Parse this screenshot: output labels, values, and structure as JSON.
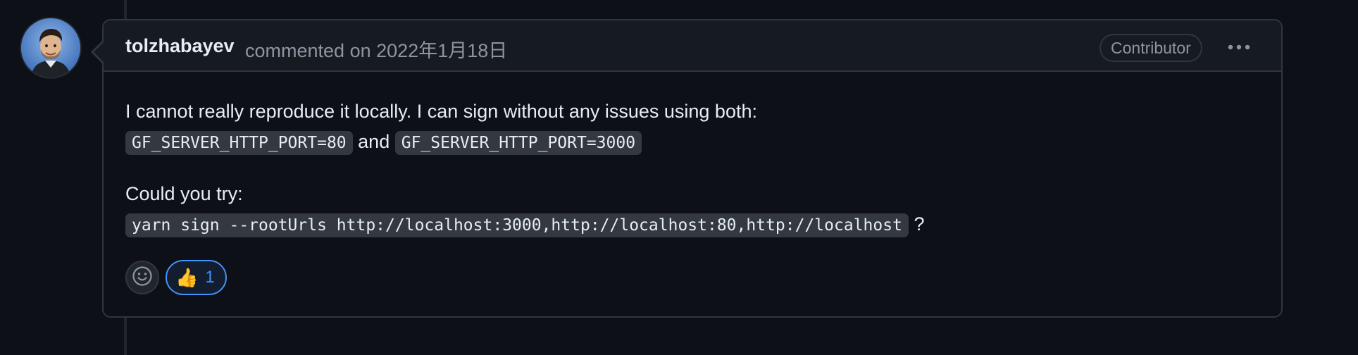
{
  "comment": {
    "author": "tolzhabayev",
    "action_text": "commented on",
    "date": "2022年1月18日",
    "role_badge": "Contributor",
    "more_icon": "kebab-horizontal-icon",
    "body": {
      "p1_text": "I cannot really reproduce it locally. I can sign without any issues using both:",
      "code_port_80": "GF_SERVER_HTTP_PORT=80",
      "and_text": "and",
      "code_port_3000": "GF_SERVER_HTTP_PORT=3000",
      "p2_text": "Could you try:",
      "code_command": "yarn sign --rootUrls http://localhost:3000,http://localhost:80,http://localhost",
      "question_mark": "?"
    },
    "reactions": {
      "picker_icon": "smiley-icon",
      "items": [
        {
          "emoji": "👍",
          "count": "1",
          "icon": "thumbs-up-icon"
        }
      ]
    }
  },
  "colors": {
    "background": "#0d1117",
    "header_bg": "#161b22",
    "border": "#30363d",
    "muted_text": "#8d96a0",
    "accent_blue": "#4493f8",
    "code_bg": "#343941"
  }
}
